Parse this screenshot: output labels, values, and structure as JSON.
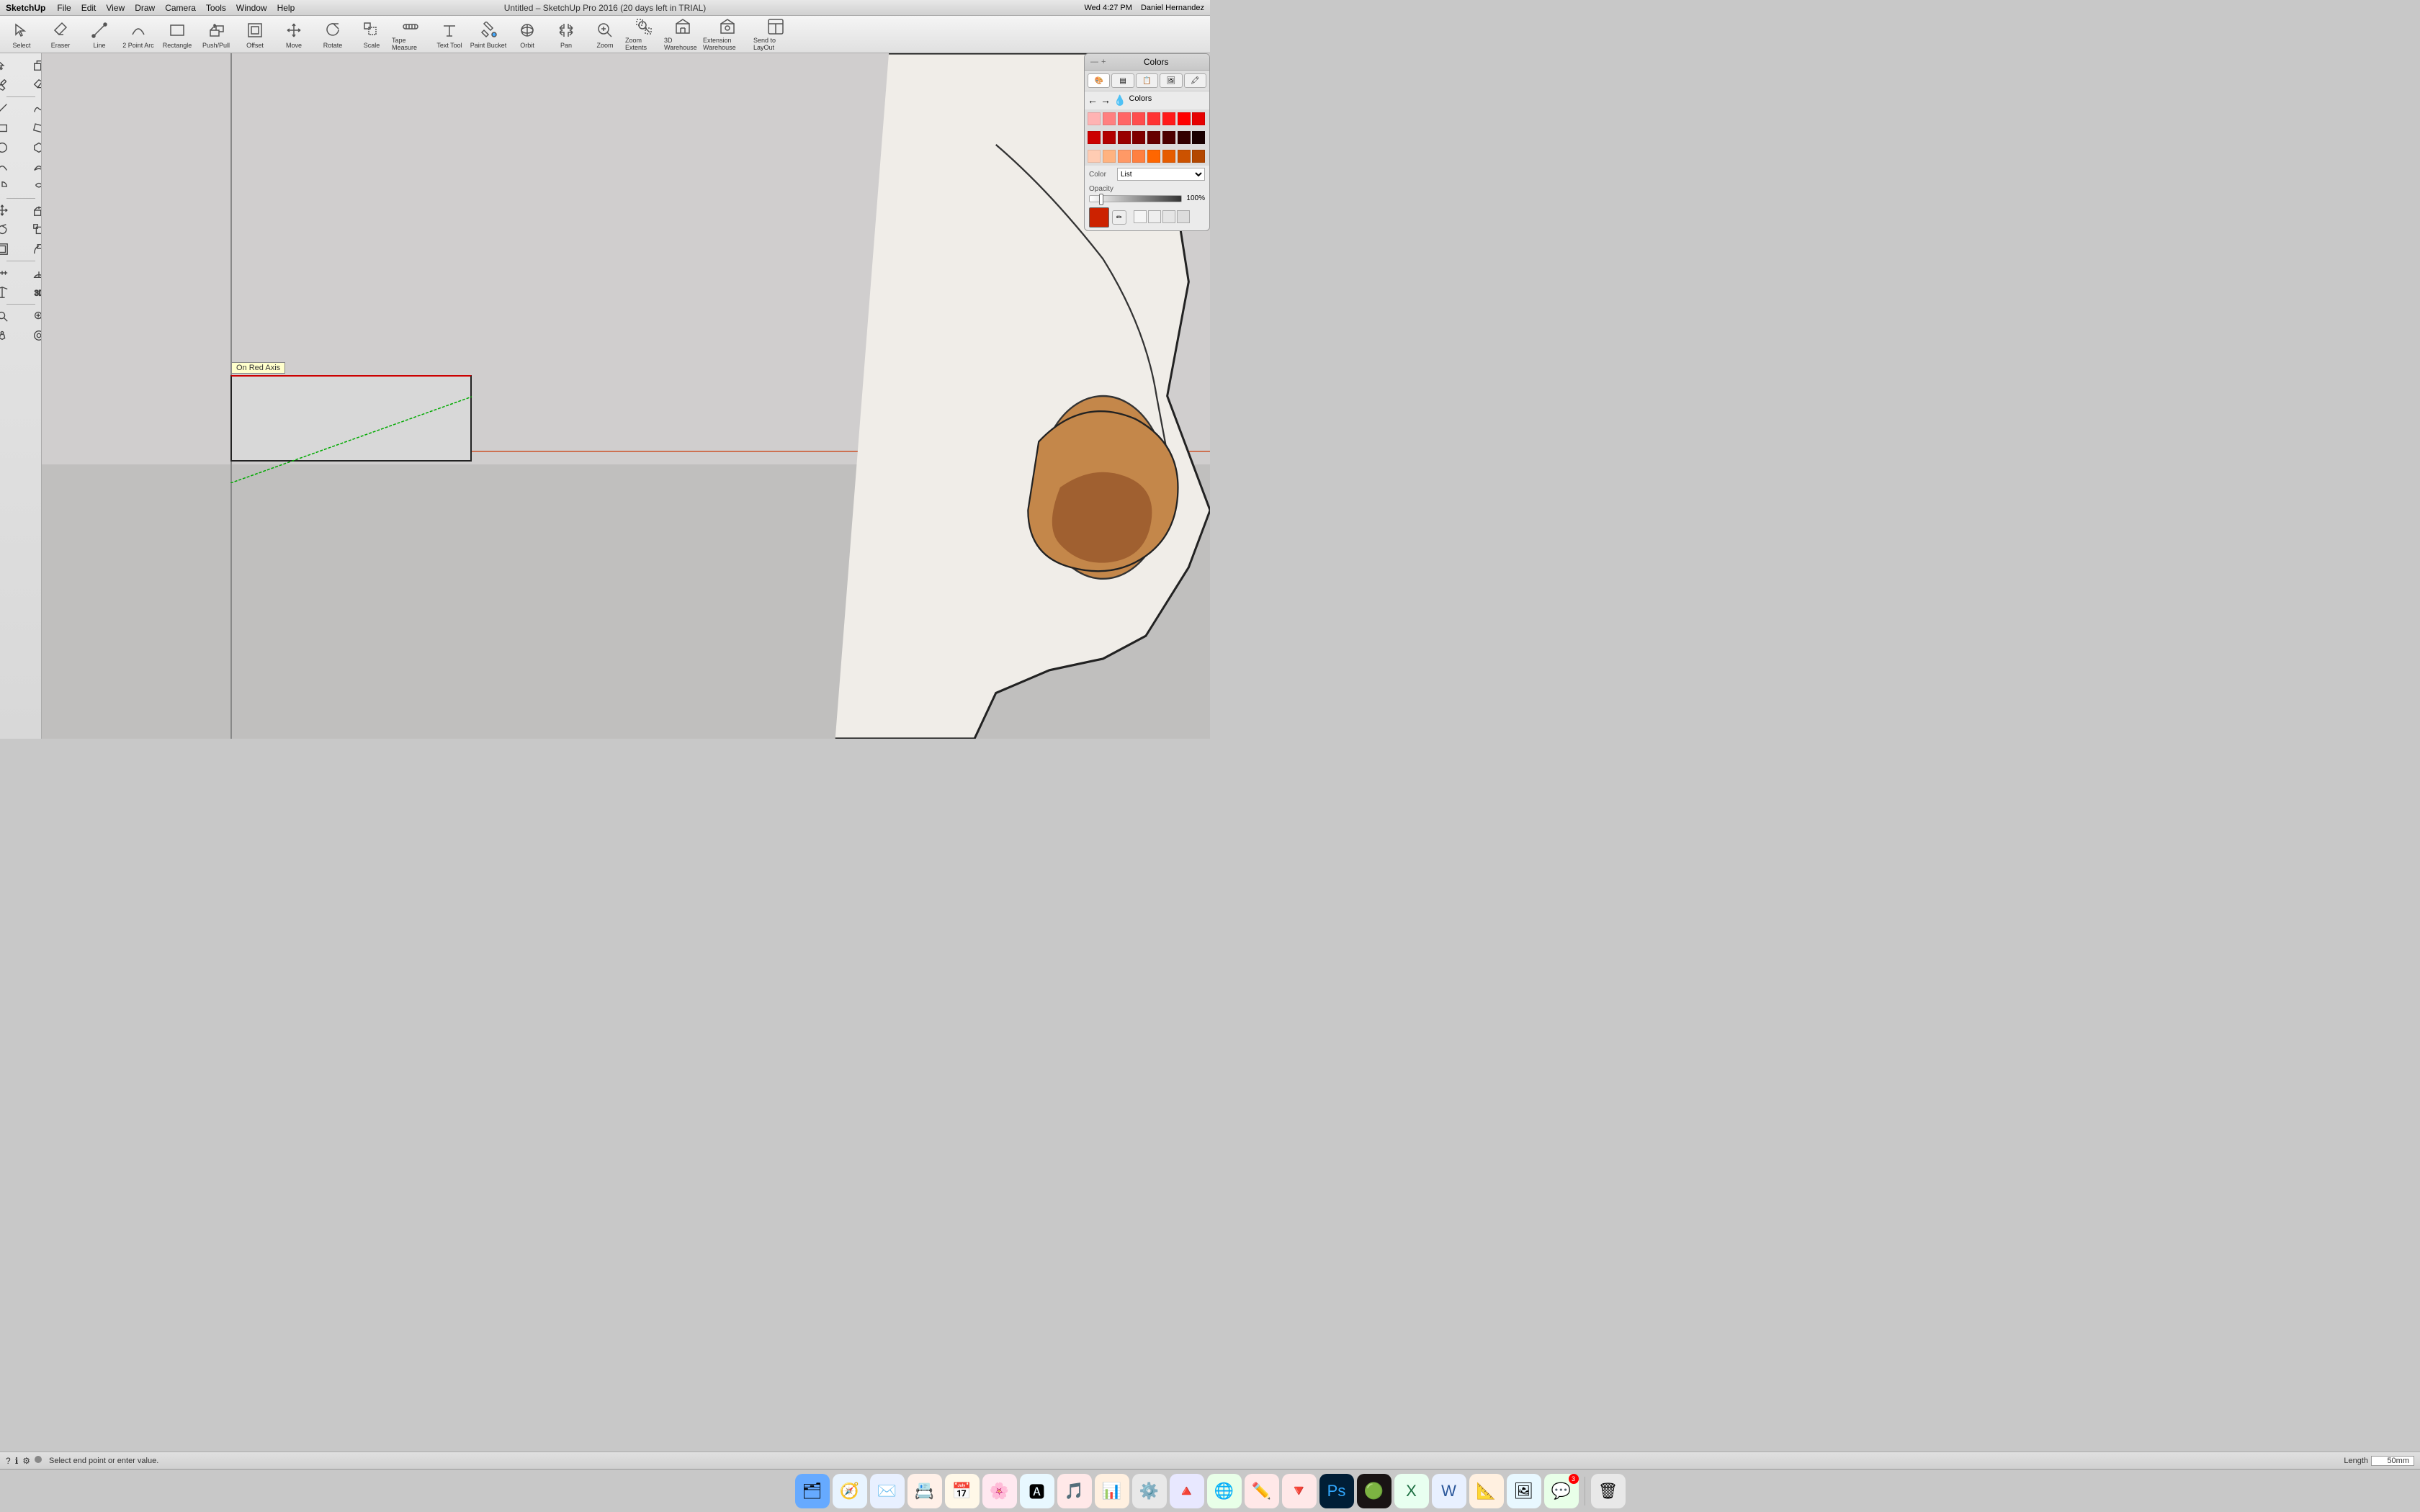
{
  "menubar": {
    "app_name": "SketchUp",
    "menus": [
      "File",
      "Edit",
      "View",
      "Draw",
      "Camera",
      "Tools",
      "Window",
      "Help"
    ],
    "title": "Untitled – SketchUp Pro 2016 (20 days left in TRIAL)",
    "right": [
      "Wed 4:27 PM",
      "Daniel Hernandez"
    ]
  },
  "toolbar": {
    "tools": [
      {
        "id": "select",
        "label": "Select",
        "icon": "arrow"
      },
      {
        "id": "eraser",
        "label": "Eraser",
        "icon": "eraser"
      },
      {
        "id": "line",
        "label": "Line",
        "icon": "line"
      },
      {
        "id": "2pt-arc",
        "label": "2 Point Arc",
        "icon": "arc"
      },
      {
        "id": "rectangle",
        "label": "Rectangle",
        "icon": "rect"
      },
      {
        "id": "pushpull",
        "label": "Push/Pull",
        "icon": "pushpull"
      },
      {
        "id": "offset",
        "label": "Offset",
        "icon": "offset"
      },
      {
        "id": "move",
        "label": "Move",
        "icon": "move"
      },
      {
        "id": "rotate",
        "label": "Rotate",
        "icon": "rotate"
      },
      {
        "id": "scale",
        "label": "Scale",
        "icon": "scale"
      },
      {
        "id": "tape",
        "label": "Tape Measure",
        "icon": "tape"
      },
      {
        "id": "text",
        "label": "Text Tool",
        "icon": "text"
      },
      {
        "id": "paint",
        "label": "Paint Bucket",
        "icon": "paint"
      },
      {
        "id": "orbit",
        "label": "Orbit",
        "icon": "orbit"
      },
      {
        "id": "pan",
        "label": "Pan",
        "icon": "pan"
      },
      {
        "id": "zoom",
        "label": "Zoom",
        "icon": "zoom"
      },
      {
        "id": "zoom-extents",
        "label": "Zoom Extents",
        "icon": "zoom-ext"
      },
      {
        "id": "3d-warehouse",
        "label": "3D Warehouse",
        "icon": "warehouse"
      },
      {
        "id": "ext-warehouse",
        "label": "Extension Warehouse",
        "icon": "ext-wh"
      },
      {
        "id": "send-layout",
        "label": "Send to LayOut",
        "icon": "layout"
      }
    ]
  },
  "canvas": {
    "tooltip": "On Red Axis",
    "status_text": "Select end point or enter value.",
    "length_label": "Length",
    "length_value": "50mm"
  },
  "colors_panel": {
    "title": "Colors",
    "tabs": [
      {
        "label": "🎨",
        "id": "wheel"
      },
      {
        "label": "🔲",
        "id": "sliders"
      },
      {
        "label": "📋",
        "id": "list"
      },
      {
        "label": "🖼",
        "id": "image"
      },
      {
        "label": "🎯",
        "id": "crayons"
      }
    ],
    "section_label": "Colors",
    "color_label": "Color",
    "list_label": "List",
    "opacity_label": "Opacity",
    "opacity_value": "100%",
    "swatches_row1": [
      "#ffb3b3",
      "#ff8080",
      "#ff6666",
      "#ff4d4d",
      "#ff3333",
      "#ff1a1a",
      "#ff0000",
      "#e60000"
    ],
    "swatches_row2": [
      "#cc0000",
      "#b30000",
      "#990000",
      "#800000",
      "#660000",
      "#4d0000",
      "#330000",
      "#1a0000"
    ],
    "swatches_row3": [
      "#ffccb3",
      "#ffb380",
      "#ff9966",
      "#ff8040",
      "#ff6600",
      "#e65c00",
      "#cc5200",
      "#b34700"
    ],
    "selected_color": "#cc2200"
  },
  "dock": {
    "items": [
      {
        "label": "Finder",
        "emoji": "🗂",
        "badge": null
      },
      {
        "label": "Safari",
        "emoji": "🧭",
        "badge": null
      },
      {
        "label": "Mail",
        "emoji": "✉️",
        "badge": null
      },
      {
        "label": "Contacts",
        "emoji": "📇",
        "badge": null
      },
      {
        "label": "Calendar",
        "emoji": "📅",
        "badge": null
      },
      {
        "label": "Photos",
        "emoji": "🌸",
        "badge": null
      },
      {
        "label": "App Store",
        "emoji": "🅰",
        "badge": null
      },
      {
        "label": "iTunes",
        "emoji": "🎵",
        "badge": null
      },
      {
        "label": "Keynote",
        "emoji": "📊",
        "badge": null
      },
      {
        "label": "System Prefs",
        "emoji": "⚙️",
        "badge": null
      },
      {
        "label": "Artstudio",
        "emoji": "🔺",
        "badge": null
      },
      {
        "label": "Chrome",
        "emoji": "🌐",
        "badge": null
      },
      {
        "label": "SketchUp",
        "emoji": "✏️",
        "badge": null
      },
      {
        "label": "Artstudio2",
        "emoji": "🔻",
        "badge": null
      },
      {
        "label": "Photoshop",
        "emoji": "🅿",
        "badge": null
      },
      {
        "label": "Spotify",
        "emoji": "🟢",
        "badge": null
      },
      {
        "label": "Excel",
        "emoji": "📈",
        "badge": null
      },
      {
        "label": "Word",
        "emoji": "📝",
        "badge": null
      },
      {
        "label": "Keynote2",
        "emoji": "📐",
        "badge": null
      },
      {
        "label": "Preview",
        "emoji": "🖼",
        "badge": null
      },
      {
        "label": "WhatsApp",
        "emoji": "💬",
        "badge": "3"
      },
      {
        "label": "Trash",
        "emoji": "🗑",
        "badge": null
      }
    ]
  },
  "sidebar": {
    "tools": [
      {
        "id": "select",
        "symbol": "↖"
      },
      {
        "id": "paint",
        "symbol": "🎨"
      },
      {
        "id": "eraser2",
        "symbol": "◻"
      },
      {
        "id": "pencil",
        "symbol": "✏"
      },
      {
        "id": "line2",
        "symbol": "╱"
      },
      {
        "id": "arc",
        "symbol": "⌒"
      },
      {
        "id": "shape",
        "symbol": "◇"
      },
      {
        "id": "circle",
        "symbol": "○"
      },
      {
        "id": "curve",
        "symbol": "〜"
      },
      {
        "id": "freehand",
        "symbol": "✍"
      },
      {
        "id": "move2",
        "symbol": "✛"
      },
      {
        "id": "pushpull2",
        "symbol": "⬆"
      },
      {
        "id": "rotate2",
        "symbol": "↻"
      },
      {
        "id": "scale2",
        "symbol": "⤡"
      },
      {
        "id": "offset2",
        "symbol": "▣"
      },
      {
        "id": "follow",
        "symbol": "→"
      },
      {
        "id": "tape2",
        "symbol": "📏"
      },
      {
        "id": "protractor",
        "symbol": "∠"
      },
      {
        "id": "text2",
        "symbol": "T"
      },
      {
        "id": "axes",
        "symbol": "⊕"
      },
      {
        "id": "dims",
        "symbol": "↔"
      },
      {
        "id": "3d-text",
        "symbol": "3"
      },
      {
        "id": "section",
        "symbol": "⊟"
      },
      {
        "id": "zoom2",
        "symbol": "🔍"
      },
      {
        "id": "walkthrough",
        "symbol": "👁"
      }
    ]
  }
}
